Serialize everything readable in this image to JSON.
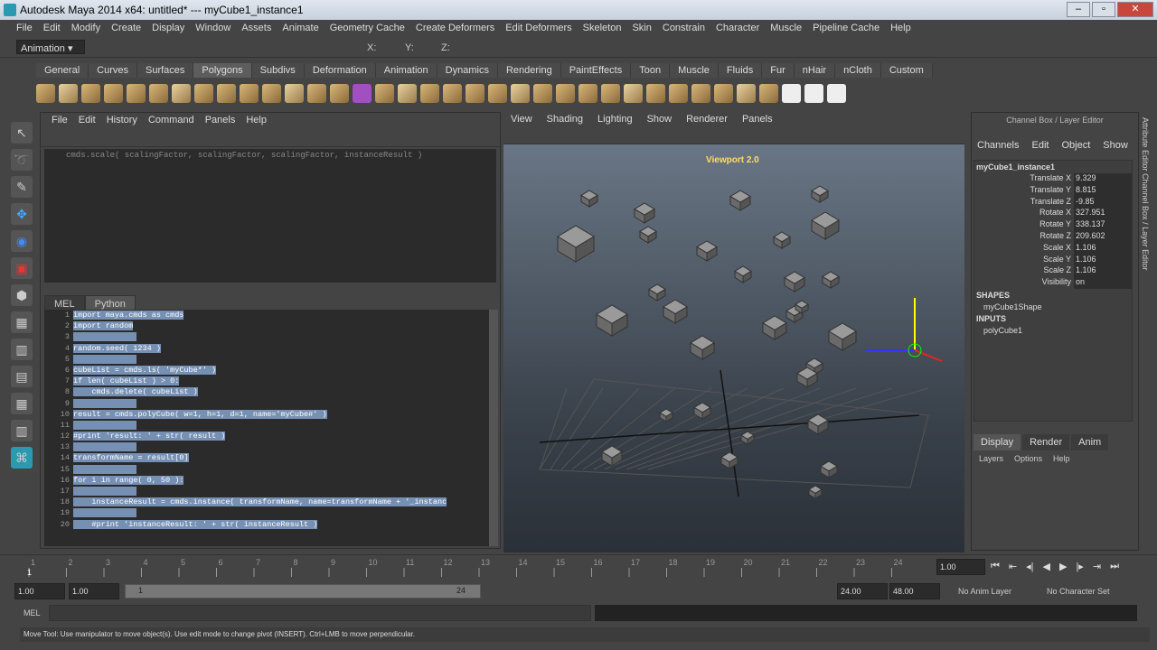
{
  "window": {
    "title": "Autodesk Maya 2014 x64: untitled*   ---   myCube1_instance1",
    "buttons": [
      "–",
      "▫",
      "✕"
    ]
  },
  "menubar": [
    "File",
    "Edit",
    "Modify",
    "Create",
    "Display",
    "Window",
    "Assets",
    "Animate",
    "Geometry Cache",
    "Create Deformers",
    "Edit Deformers",
    "Skeleton",
    "Skin",
    "Constrain",
    "Character",
    "Muscle",
    "Pipeline Cache",
    "Help"
  ],
  "status": {
    "menuset": "Animation",
    "x_label": "X:",
    "y_label": "Y:",
    "z_label": "Z:"
  },
  "shelf_tabs": [
    "General",
    "Curves",
    "Surfaces",
    "Polygons",
    "Subdivs",
    "Deformation",
    "Animation",
    "Dynamics",
    "Rendering",
    "PaintEffects",
    "Toon",
    "Muscle",
    "Fluids",
    "Fur",
    "nHair",
    "nCloth",
    "Custom"
  ],
  "shelf_active": "Polygons",
  "script_editor": {
    "menu": [
      "File",
      "Edit",
      "History",
      "Command",
      "Panels",
      "Help"
    ],
    "history": "cmds.scale( scalingFactor, scalingFactor, scalingFactor, instanceResult )",
    "tabs": [
      "MEL",
      "Python"
    ],
    "lines": [
      {
        "n": "1",
        "code": "import maya.cmds as cmds"
      },
      {
        "n": "2",
        "code": "import random"
      },
      {
        "n": "3",
        "code": ""
      },
      {
        "n": "4",
        "code": "random.seed( 1234 )"
      },
      {
        "n": "5",
        "code": ""
      },
      {
        "n": "6",
        "code": "cubeList = cmds.ls( 'myCube*' )"
      },
      {
        "n": "7",
        "code": "if len( cubeList ) > 0:"
      },
      {
        "n": "8",
        "code": "    cmds.delete( cubeList )"
      },
      {
        "n": "9",
        "code": ""
      },
      {
        "n": "10",
        "code": "result = cmds.polyCube( w=1, h=1, d=1, name='myCube#' )"
      },
      {
        "n": "11",
        "code": ""
      },
      {
        "n": "12",
        "code": "#print 'result: ' + str( result )"
      },
      {
        "n": "13",
        "code": ""
      },
      {
        "n": "14",
        "code": "transformName = result[0]"
      },
      {
        "n": "15",
        "code": ""
      },
      {
        "n": "16",
        "code": "for i in range( 0, 50 ):"
      },
      {
        "n": "17",
        "code": ""
      },
      {
        "n": "18",
        "code": "    instanceResult = cmds.instance( transformName, name=transformName + '_instanc"
      },
      {
        "n": "19",
        "code": ""
      },
      {
        "n": "20",
        "code": "    #print 'instanceResult: ' + str( instanceResult )"
      }
    ]
  },
  "viewport": {
    "menu": [
      "View",
      "Shading",
      "Lighting",
      "Show",
      "Renderer",
      "Panels"
    ],
    "label": "Viewport 2.0"
  },
  "channel_box": {
    "header": "Channel Box / Layer Editor",
    "menu": [
      "Channels",
      "Edit",
      "Object",
      "Show"
    ],
    "object": "myCube1_instance1",
    "channels": [
      {
        "name": "Translate X",
        "value": "9.329"
      },
      {
        "name": "Translate Y",
        "value": "8.815"
      },
      {
        "name": "Translate Z",
        "value": "-9.85"
      },
      {
        "name": "Rotate X",
        "value": "327.951"
      },
      {
        "name": "Rotate Y",
        "value": "338.137"
      },
      {
        "name": "Rotate Z",
        "value": "209.602"
      },
      {
        "name": "Scale X",
        "value": "1.106"
      },
      {
        "name": "Scale Y",
        "value": "1.106"
      },
      {
        "name": "Scale Z",
        "value": "1.106"
      },
      {
        "name": "Visibility",
        "value": "on"
      }
    ],
    "shapes_label": "SHAPES",
    "shape": "myCube1Shape",
    "inputs_label": "INPUTS",
    "input": "polyCube1",
    "side_tabs": "Attribute Editor   Channel Box / Layer Editor",
    "layer_tabs": [
      "Display",
      "Render",
      "Anim"
    ],
    "layer_menu": [
      "Layers",
      "Options",
      "Help"
    ]
  },
  "timeline": {
    "ticks": [
      "1",
      "2",
      "3",
      "4",
      "5",
      "6",
      "7",
      "8",
      "9",
      "10",
      "11",
      "12",
      "13",
      "14",
      "15",
      "16",
      "17",
      "18",
      "19",
      "20",
      "21",
      "22",
      "23",
      "24"
    ],
    "current": "1",
    "current_field": "1.00"
  },
  "range": {
    "start": "1.00",
    "playstart": "1.00",
    "slider_start": "1",
    "slider_end": "24",
    "playend": "24.00",
    "end": "48.00",
    "anim_layer": "No Anim Layer",
    "char_set": "No Character Set"
  },
  "command": {
    "lang": "MEL"
  },
  "help_line": "Move Tool: Use manipulator to move object(s). Use edit mode to change pivot (INSERT). Ctrl+LMB to move perpendicular."
}
